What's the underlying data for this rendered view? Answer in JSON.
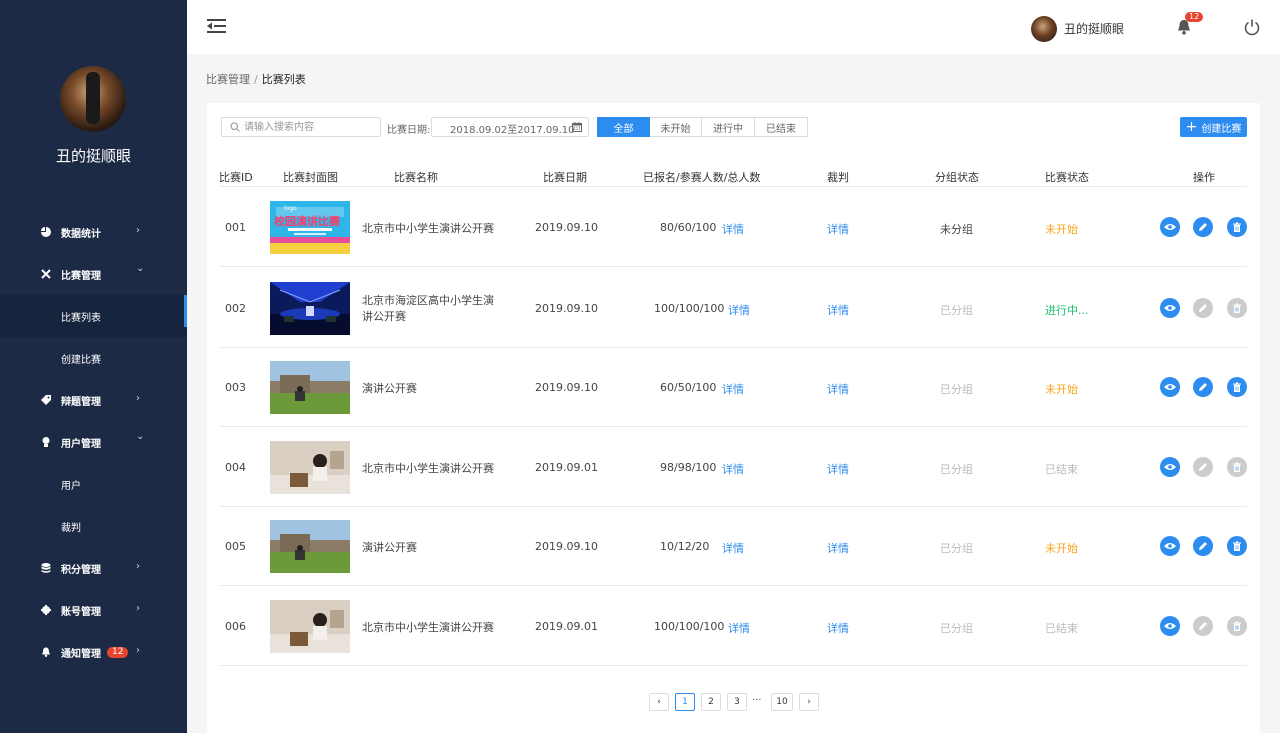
{
  "sidebar": {
    "username": "丑的挺顺眼",
    "items": [
      {
        "label": "数据统计",
        "icon": "pie-chart-icon",
        "chevron": "›"
      },
      {
        "label": "比赛管理",
        "icon": "cross-icon",
        "chevron": "⌄"
      },
      {
        "label": "比赛列表",
        "sub": true
      },
      {
        "label": "创建比赛",
        "sub": true
      },
      {
        "label": "辩题管理",
        "icon": "tag-icon",
        "chevron": "›"
      },
      {
        "label": "用户管理",
        "icon": "user-icon",
        "chevron": "⌄"
      },
      {
        "label": "用户",
        "sub": true
      },
      {
        "label": "裁判",
        "sub": true
      },
      {
        "label": "积分管理",
        "icon": "database-icon",
        "chevron": "›"
      },
      {
        "label": "账号管理",
        "icon": "gear-icon",
        "chevron": "›"
      },
      {
        "label": "通知管理",
        "icon": "bell-icon",
        "chevron": "›",
        "badge": "12"
      }
    ]
  },
  "header": {
    "username": "丑的挺顺眼",
    "bell_badge": "12"
  },
  "breadcrumb": {
    "parent": "比赛管理",
    "separator": "/",
    "current": "比赛列表"
  },
  "toolbar": {
    "search_placeholder": "请输入搜索内容",
    "date_label": "比赛日期:",
    "date_value": "2018.09.02至2017.09.10",
    "filters": [
      "全部",
      "未开始",
      "进行中",
      "已结束"
    ],
    "create_label": "创建比赛",
    "create_icon": "+"
  },
  "table": {
    "headers": [
      "比赛ID",
      "比赛封面图",
      "比赛名称",
      "比赛日期",
      "已报名/参赛人数/总人数",
      "裁判",
      "分组状态",
      "比赛状态",
      "操作"
    ],
    "rows": [
      {
        "id": "001",
        "name": "北京市中小学生演讲公开赛",
        "date": "2019.09.10",
        "counts": "80/60/100",
        "detail": "详情",
        "judge": "详情",
        "group": "未分组",
        "status": "未开始",
        "status_color": "#f5a623",
        "cover": "campus-poster"
      },
      {
        "id": "002",
        "name": "北京市海淀区高中小学生演讲公开赛",
        "date": "2019.09.10",
        "counts": "100/100/100",
        "detail": "详情",
        "judge": "详情",
        "group": "已分组",
        "status": "进行中...",
        "status_color": "#19be6b",
        "cover": "stage"
      },
      {
        "id": "003",
        "name": "演讲公开赛",
        "date": "2019.09.10",
        "counts": "60/50/100",
        "detail": "详情",
        "judge": "详情",
        "group": "已分组",
        "status": "未开始",
        "status_color": "#f5a623",
        "cover": "wall-photo"
      },
      {
        "id": "004",
        "name": "北京市中小学生演讲公开赛",
        "date": "2019.09.01",
        "counts": "98/98/100",
        "detail": "详情",
        "judge": "详情",
        "group": "已分组",
        "status": "已结束",
        "status_color": "#bbbbbb",
        "cover": "portrait"
      },
      {
        "id": "005",
        "name": "演讲公开赛",
        "date": "2019.09.10",
        "counts": "10/12/20",
        "detail": "详情",
        "judge": "详情",
        "group": "已分组",
        "status": "未开始",
        "status_color": "#f5a623",
        "cover": "wall-photo"
      },
      {
        "id": "006",
        "name": "北京市中小学生演讲公开赛",
        "date": "2019.09.01",
        "counts": "100/100/100",
        "detail": "详情",
        "judge": "详情",
        "group": "已分组",
        "status": "已结束",
        "status_color": "#bbbbbb",
        "cover": "portrait"
      }
    ]
  },
  "poster_text": {
    "logo": "logo",
    "title": "校园演讲比赛"
  },
  "pagination": {
    "pages": [
      "1",
      "2",
      "3",
      "10"
    ],
    "ellipsis": "···",
    "prev": "‹",
    "next": "›",
    "current": "1"
  },
  "colors": {
    "sidebar": "#1c2a45",
    "accent": "#2d8cf0",
    "warning": "#f5a623",
    "success": "#19be6b",
    "danger": "#e8452f"
  }
}
